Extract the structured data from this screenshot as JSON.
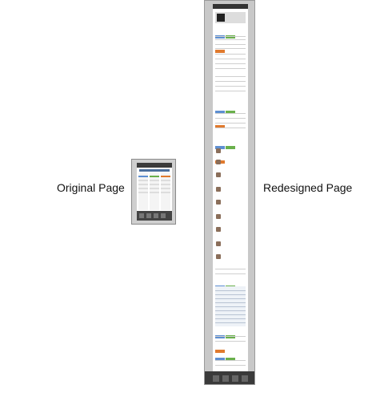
{
  "labels": {
    "original": "Original Page",
    "redesigned": "Redesigned Page"
  }
}
